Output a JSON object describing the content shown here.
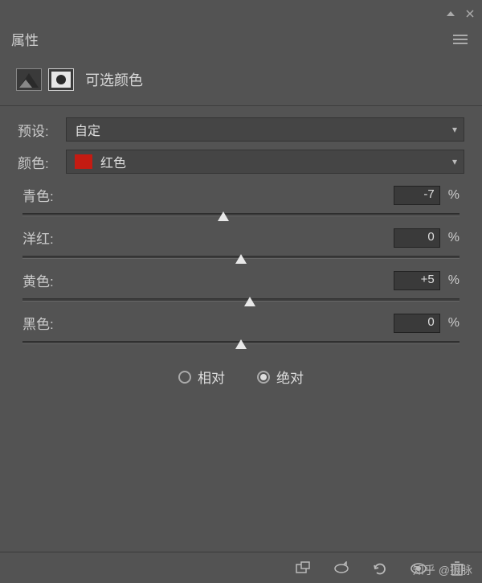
{
  "panel": {
    "title": "属性"
  },
  "header": {
    "adjustment_name": "可选颜色"
  },
  "preset": {
    "label": "预设:",
    "value": "自定"
  },
  "color": {
    "label": "颜色:",
    "value": "红色",
    "swatch": "#c41b12"
  },
  "sliders": {
    "cyan": {
      "label": "青色:",
      "value": "-7",
      "percent": 46
    },
    "magenta": {
      "label": "洋红:",
      "value": "0",
      "percent": 50
    },
    "yellow": {
      "label": "黄色:",
      "value": "+5",
      "percent": 52
    },
    "black": {
      "label": "黑色:",
      "value": "0",
      "percent": 50
    }
  },
  "method": {
    "relative": {
      "label": "相对",
      "checked": false
    },
    "absolute": {
      "label": "绝对",
      "checked": true
    }
  },
  "unit": "%",
  "watermark": "知乎 @摄脉"
}
